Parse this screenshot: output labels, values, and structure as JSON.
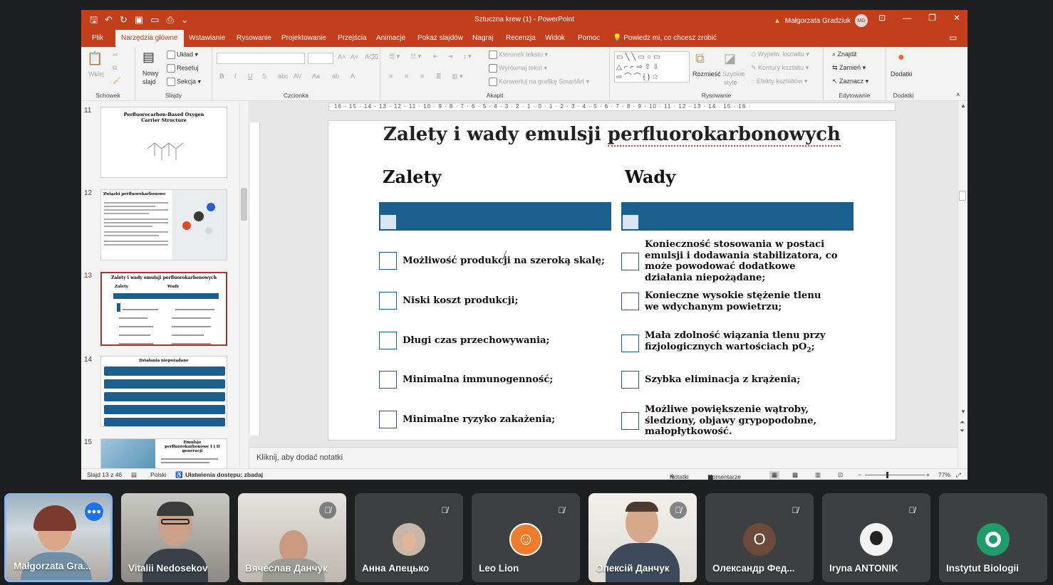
{
  "app": {
    "doc_title": "Sztuczna krew (1)  -  PowerPoint",
    "warning_icon": "warning-icon",
    "user_name": "Małgorzata Gradziuk",
    "user_initials": "MG",
    "tabs": [
      "Plik",
      "Narzędzia główne",
      "Wstawianie",
      "Rysowanie",
      "Projektowanie",
      "Przejścia",
      "Animacje",
      "Pokaz slajdów",
      "Nagraj",
      "Recenzja",
      "Widok",
      "Pomoc"
    ],
    "tell_me": "Powiedz mi, co chcesz zrobić"
  },
  "ribbon": {
    "schowek": {
      "label": "Schowek",
      "paste": "Wklej"
    },
    "slajdy": {
      "label": "Slajdy",
      "new_slide_1": "Nowy",
      "new_slide_2": "slajd",
      "layout": "Układ",
      "reset": "Resetuj",
      "section": "Sekcja"
    },
    "czcionka": {
      "label": "Czcionka",
      "bold": "B",
      "italic": "I",
      "underline": "U",
      "strike": "S"
    },
    "akapit": {
      "label": "Akapit",
      "text_direction": "Kierunek tekstu",
      "align_text": "Wyrównaj tekst",
      "smartart": "Konwertuj na grafikę SmartArt"
    },
    "rysowanie": {
      "label": "Rysowanie",
      "arrange": "Rozmieść",
      "quick_styles_1": "Szybkie",
      "quick_styles_2": "style",
      "fill": "Wypełn. kształtu",
      "outline": "Kontury kształtu",
      "effects": "Efekty kształtów"
    },
    "edytowanie": {
      "label": "Edytowanie",
      "find": "Znajdź",
      "replace": "Zamień",
      "select": "Zaznacz"
    },
    "dodatki": {
      "label": "Dodatki",
      "addins": "Dodatki"
    }
  },
  "thumbnails": [
    {
      "num": "11",
      "title": "Perfluorocarbon-Based Oxygen Carrier Structure"
    },
    {
      "num": "12",
      "title": "Związki perfluorokarbonowe"
    },
    {
      "num": "13",
      "title": "Zalety i wady emulsji perfluorokarbonowych",
      "col1": "Zalety",
      "col2": "Wady"
    },
    {
      "num": "14",
      "title": "Działania niepożądane"
    },
    {
      "num": "15",
      "title": "Emulsje perfluorokarbonowe I i II generacji"
    }
  ],
  "slide": {
    "title_prefix": "Zalety i wady emulsji ",
    "title_word": "perfluorokarbonowych",
    "col_left": "Zalety",
    "col_right": "Wady",
    "zalety": [
      "Możliwość produkcji na szeroką skalę;",
      "Niski koszt produkcji;",
      "Długi czas przechowywania;",
      "Minimalna immunogenność;",
      "Minimalne ryzyko zakażenia;"
    ],
    "wady": [
      "Konieczność stosowania w postaci emulsji i dodawania stabilizatora, co może powodować dodatkowe działania niepożądane;",
      "Konieczne wysokie stężenie tlenu we wdychanym powietrzu;",
      "Mała zdolność wiązania tlenu przy fizjologicznych wartościach pO",
      "Szybka eliminacja z krążenia;",
      "Możliwe powiększenie wątroby, śledziony, objawy grypopodobne, małopłytkowość."
    ],
    "wady_po2_sub": "2",
    "wady_po2_end": ";"
  },
  "ruler": "· 16 · 15 · 14 · 13 · 12 · 11 · 10 · 9 · 8 · 7 · 6 · 5 · 4 · 3 · 2 · 1 · 0 · 1 · 2 · 3 · 4 · 5 · 6 · 7 · 8 · 9 · 10 · 11 · 12 · 13 · 14 · 15 · 16 ·",
  "notes_placeholder": "Kliknij, aby dodać notatki",
  "status": {
    "slide": "Slajd 13 z 46",
    "language": "Polski",
    "accessibility": "Ułatwienia dostępu: zbadaj",
    "notes": "Notatki",
    "comments": "Komentarze",
    "zoom": "77%"
  },
  "participants": [
    {
      "name": "Małgorzata Gra...",
      "speaking": true
    },
    {
      "name": "Vitalii Nedosekov",
      "muted": false
    },
    {
      "name": "Вячеслав Данчук",
      "muted": true
    },
    {
      "name": "Анна Апецько",
      "muted": true
    },
    {
      "name": "Leo Lion",
      "muted": true
    },
    {
      "name": "Олексій Данчук",
      "muted": true
    },
    {
      "name": "Олександр Фед...",
      "muted": true,
      "initial": "О"
    },
    {
      "name": "Iryna ANTONIK",
      "muted": true
    },
    {
      "name": "Instytut Biologii",
      "muted": false
    }
  ],
  "colors": {
    "accent": "#c43e1c",
    "bar": "#1a5f8e",
    "speaking": "#1a73e8"
  }
}
